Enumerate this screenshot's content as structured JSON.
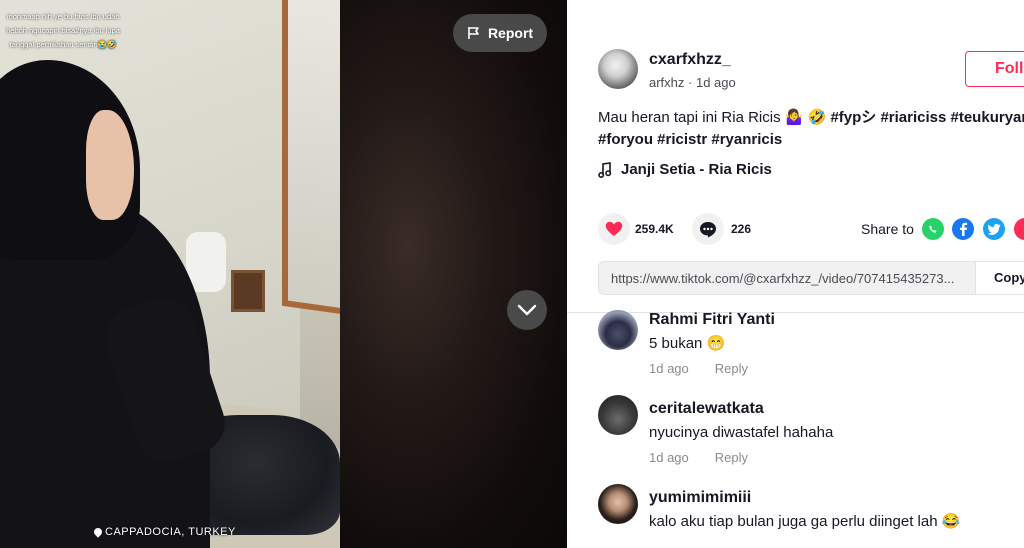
{
  "video": {
    "overlay_text": "monmaap nih ye bu fans ibu udah heboh ngucapin bisa2nya ibu lupa tanggal pernikahan sendiri😭🤣",
    "location": "CAPPADOCIA, TURKEY",
    "report_label": "Report"
  },
  "author": {
    "username": "cxarfxhzz_",
    "nickname": "arfxhz",
    "time": "1d ago",
    "follow_label": "Follow"
  },
  "caption": {
    "line1_text": "Mau heran tapi ini Ria Ricis 🤷‍♀️ 🤣 ",
    "line1_tags": "#fypシ #riariciss #teukuryan",
    "line2_tags": "#foryou #ricistr #ryanricis"
  },
  "music": {
    "title": "Janji Setia - Ria Ricis"
  },
  "stats": {
    "likes": "259.4K",
    "comments": "226"
  },
  "share": {
    "label": "Share to",
    "icons": [
      "whatsapp-icon",
      "facebook-icon",
      "twitter-icon",
      "more-share-icon"
    ]
  },
  "link": {
    "url": "https://www.tiktok.com/@cxarfxhzz_/video/707415435273...",
    "copy_label": "Copy link"
  },
  "comments": [
    {
      "name": "Rahmi Fitri Yanti",
      "text": "5 bukan 😁",
      "time": "1d ago",
      "reply": "Reply"
    },
    {
      "name": "ceritalewatkata",
      "text": "nyucinya diwastafel hahaha",
      "time": "1d ago",
      "reply": "Reply"
    },
    {
      "name": "yumimimimiii",
      "text": "kalo aku tiap bulan juga ga perlu diinget lah 😂",
      "time": "",
      "reply": ""
    }
  ],
  "colors": {
    "accent": "#fe2c55",
    "text": "#161823",
    "muted": "#8a8b91"
  }
}
